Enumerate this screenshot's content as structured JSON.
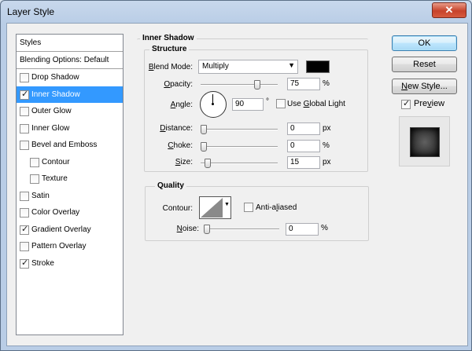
{
  "window": {
    "title": "Layer Style",
    "close_glyph": "✕"
  },
  "styles": {
    "header": "Styles",
    "blending": "Blending Options: Default",
    "items": [
      {
        "label": "Drop Shadow",
        "checked": false
      },
      {
        "label": "Inner Shadow",
        "checked": true,
        "selected": true
      },
      {
        "label": "Outer Glow",
        "checked": false
      },
      {
        "label": "Inner Glow",
        "checked": false
      },
      {
        "label": "Bevel and Emboss",
        "checked": false
      },
      {
        "label": "Contour",
        "checked": false,
        "indent": true
      },
      {
        "label": "Texture",
        "checked": false,
        "indent": true
      },
      {
        "label": "Satin",
        "checked": false
      },
      {
        "label": "Color Overlay",
        "checked": false
      },
      {
        "label": "Gradient Overlay",
        "checked": true
      },
      {
        "label": "Pattern Overlay",
        "checked": false
      },
      {
        "label": "Stroke",
        "checked": true
      }
    ]
  },
  "inner_shadow": {
    "title": "Inner Shadow",
    "structure_title": "Structure",
    "blend_mode_label": "Blend Mode:",
    "blend_mode_value": "Multiply",
    "shadow_color": "#000000",
    "opacity_label": "Opacity:",
    "opacity_value": "75",
    "opacity_unit": "%",
    "opacity_level": 0.75,
    "angle_label": "Angle:",
    "angle_value": "90",
    "angle_unit": "°",
    "use_global_light": "Use Global Light",
    "use_global_light_checked": false,
    "distance_label": "Distance:",
    "distance_value": "0",
    "distance_unit": "px",
    "distance_level": 0,
    "choke_label": "Choke:",
    "choke_value": "0",
    "choke_unit": "%",
    "choke_level": 0,
    "size_label": "Size:",
    "size_value": "15",
    "size_unit": "px",
    "size_level": 0.06
  },
  "quality": {
    "title": "Quality",
    "contour_label": "Contour:",
    "anti_aliased": "Anti-aliased",
    "anti_aliased_checked": false,
    "noise_label": "Noise:",
    "noise_value": "0",
    "noise_unit": "%",
    "noise_level": 0
  },
  "buttons": {
    "ok": "OK",
    "reset": "Reset",
    "new_style": "New Style...",
    "preview": "Preview",
    "preview_checked": true
  }
}
